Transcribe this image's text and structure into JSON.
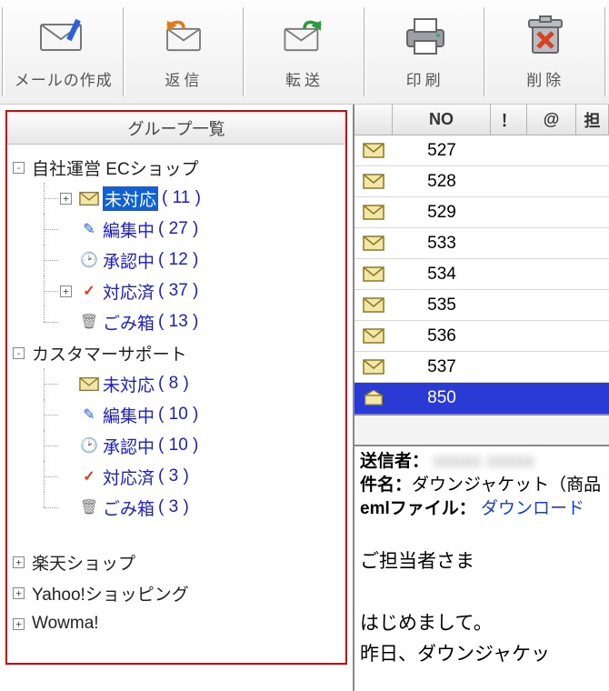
{
  "toolbar": {
    "compose": "メールの作成",
    "reply": "返信",
    "forward": "転送",
    "print": "印刷",
    "delete": "削除"
  },
  "sidebar": {
    "title": "グループ一覧",
    "groups": [
      {
        "name": "自社運営 ECショップ",
        "expanded": true,
        "folders": [
          {
            "key": "unhandled",
            "label": "未対応",
            "count": 11,
            "icon": "envelope",
            "selected": true,
            "expandable": true
          },
          {
            "key": "editing",
            "label": "編集中",
            "count": 27,
            "icon": "pencil"
          },
          {
            "key": "approving",
            "label": "承認中",
            "count": 12,
            "icon": "clock"
          },
          {
            "key": "done",
            "label": "対応済",
            "count": 37,
            "icon": "check",
            "expandable": true
          },
          {
            "key": "trash",
            "label": "ごみ箱",
            "count": 13,
            "icon": "trash"
          }
        ]
      },
      {
        "name": "カスタマーサポート",
        "expanded": true,
        "folders": [
          {
            "key": "unhandled",
            "label": "未対応",
            "count": 8,
            "icon": "envelope"
          },
          {
            "key": "editing",
            "label": "編集中",
            "count": 10,
            "icon": "pencil"
          },
          {
            "key": "approving",
            "label": "承認中",
            "count": 10,
            "icon": "clock"
          },
          {
            "key": "done",
            "label": "対応済",
            "count": 3,
            "icon": "check"
          },
          {
            "key": "trash",
            "label": "ごみ箱",
            "count": 3,
            "icon": "trash"
          }
        ]
      },
      {
        "name": "楽天ショップ",
        "expanded": false
      },
      {
        "name": "Yahoo!ショッピング",
        "expanded": false
      },
      {
        "name": "Wowma!",
        "expanded": false
      }
    ]
  },
  "list": {
    "columns": {
      "no": "NO",
      "bang": "！",
      "at": "@",
      "owner": "担"
    },
    "rows": [
      {
        "no": 527
      },
      {
        "no": 528
      },
      {
        "no": 529
      },
      {
        "no": 533
      },
      {
        "no": 534
      },
      {
        "no": 535
      },
      {
        "no": 536
      },
      {
        "no": 537
      },
      {
        "no": 850,
        "selected": true,
        "open": true
      }
    ]
  },
  "preview": {
    "sender_label": "送信者：",
    "subject_label": "件名：",
    "subject": "ダウンジャケット（商品",
    "eml_label": "emlファイル：",
    "eml_link": "ダウンロード",
    "body1": "ご担当者さま",
    "body2": "はじめまして。",
    "body3": "昨日、ダウンジャケッ"
  }
}
